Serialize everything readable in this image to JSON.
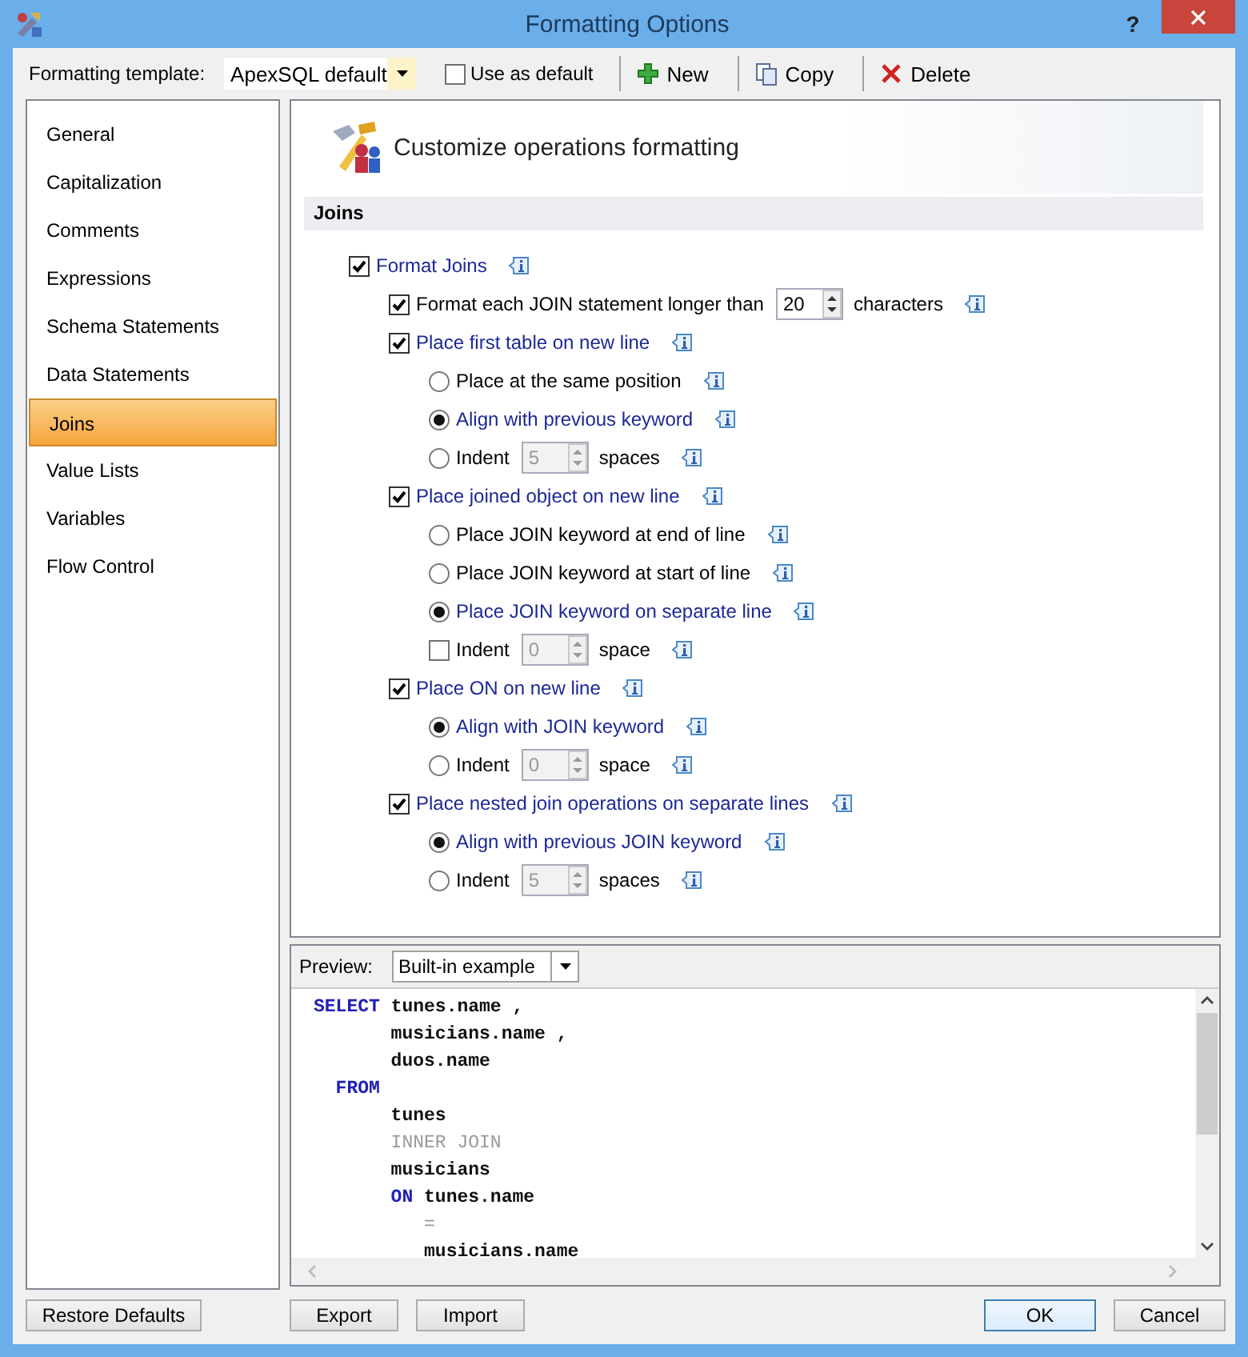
{
  "window": {
    "title": "Formatting Options",
    "help": "?"
  },
  "toolbar": {
    "template_label": "Formatting template:",
    "template_value": "ApexSQL default",
    "use_as_default": {
      "label": "Use as default",
      "checked": false
    },
    "buttons": [
      {
        "kind": "new",
        "label": "New"
      },
      {
        "kind": "copy",
        "label": "Copy"
      },
      {
        "kind": "delete",
        "label": "Delete"
      }
    ]
  },
  "sidebar": {
    "items": [
      {
        "label": "General",
        "selected": false
      },
      {
        "label": "Capitalization",
        "selected": false
      },
      {
        "label": "Comments",
        "selected": false
      },
      {
        "label": "Expressions",
        "selected": false
      },
      {
        "label": "Schema Statements",
        "selected": false
      },
      {
        "label": "Data Statements",
        "selected": false
      },
      {
        "label": "Joins",
        "selected": true
      },
      {
        "label": "Value Lists",
        "selected": false
      },
      {
        "label": "Variables",
        "selected": false
      },
      {
        "label": "Flow Control",
        "selected": false
      }
    ]
  },
  "page": {
    "title": "Customize operations formatting",
    "section": "Joins",
    "options": [
      {
        "kind": "checkbox",
        "label": "Format Joins",
        "checked": true,
        "children": [
          {
            "kind": "checkbox",
            "label": "Format each JOIN statement longer than",
            "checked": true,
            "spin": {
              "value": "20",
              "disabled": false
            },
            "unit": "characters"
          },
          {
            "kind": "checkbox",
            "label": "Place first table on new line",
            "checked": true,
            "children": [
              {
                "kind": "radio",
                "label": "Place at the same position",
                "checked": false
              },
              {
                "kind": "radio",
                "label": "Align with previous keyword",
                "checked": true
              },
              {
                "kind": "radio",
                "label": "Indent",
                "checked": false,
                "spin": {
                  "value": "5",
                  "disabled": true
                },
                "unit": "spaces"
              }
            ]
          },
          {
            "kind": "checkbox",
            "label": "Place joined object on new line",
            "checked": true,
            "children": [
              {
                "kind": "radio",
                "label": "Place JOIN keyword at end of line",
                "checked": false
              },
              {
                "kind": "radio",
                "label": "Place JOIN keyword at start of line",
                "checked": false
              },
              {
                "kind": "radio",
                "label": "Place JOIN keyword on separate line",
                "checked": true
              },
              {
                "kind": "checkbox",
                "label": "Indent",
                "checked": false,
                "spin": {
                  "value": "0",
                  "disabled": true
                },
                "unit": "space"
              }
            ]
          },
          {
            "kind": "checkbox",
            "label": "Place ON on new line",
            "checked": true,
            "children": [
              {
                "kind": "radio",
                "label": "Align with JOIN keyword",
                "checked": true
              },
              {
                "kind": "radio",
                "label": "Indent",
                "checked": false,
                "spin": {
                  "value": "0",
                  "disabled": true
                },
                "unit": "space"
              }
            ]
          },
          {
            "kind": "checkbox",
            "label": "Place nested join operations on separate lines",
            "checked": true,
            "children": [
              {
                "kind": "radio",
                "label": "Align with previous JOIN keyword",
                "checked": true
              },
              {
                "kind": "radio",
                "label": "Indent",
                "checked": false,
                "spin": {
                  "value": "5",
                  "disabled": true
                },
                "unit": "spaces"
              }
            ]
          }
        ]
      }
    ]
  },
  "preview": {
    "label": "Preview:",
    "source": "Built-in example",
    "code": [
      [
        {
          "kind": "keyword",
          "text": "SELECT"
        },
        {
          "kind": "plain",
          "text": " tunes.name ,"
        }
      ],
      [
        {
          "kind": "plain",
          "text": "       musicians.name ,"
        }
      ],
      [
        {
          "kind": "plain",
          "text": "       duos.name"
        }
      ],
      [
        {
          "kind": "keyword",
          "text": "  FROM"
        }
      ],
      [
        {
          "kind": "plain",
          "text": "       tunes"
        }
      ],
      [
        {
          "kind": "muted",
          "text": "       INNER JOIN"
        }
      ],
      [
        {
          "kind": "plain",
          "text": "       musicians"
        }
      ],
      [
        {
          "kind": "keyword",
          "text": "       ON"
        },
        {
          "kind": "plain",
          "text": " tunes.name"
        }
      ],
      [
        {
          "kind": "muted",
          "text": "          ="
        }
      ],
      [
        {
          "kind": "plain",
          "text": "          musicians.name"
        }
      ]
    ]
  },
  "buttons": [
    {
      "kind": "sidebar",
      "label": "Restore Defaults",
      "default": false
    },
    {
      "kind": "preview",
      "label": "Export",
      "default": false
    },
    {
      "kind": "preview",
      "label": "Import",
      "default": false
    },
    {
      "kind": "dialog",
      "label": "OK",
      "default": true
    },
    {
      "kind": "dialog",
      "label": "Cancel",
      "default": false
    }
  ]
}
